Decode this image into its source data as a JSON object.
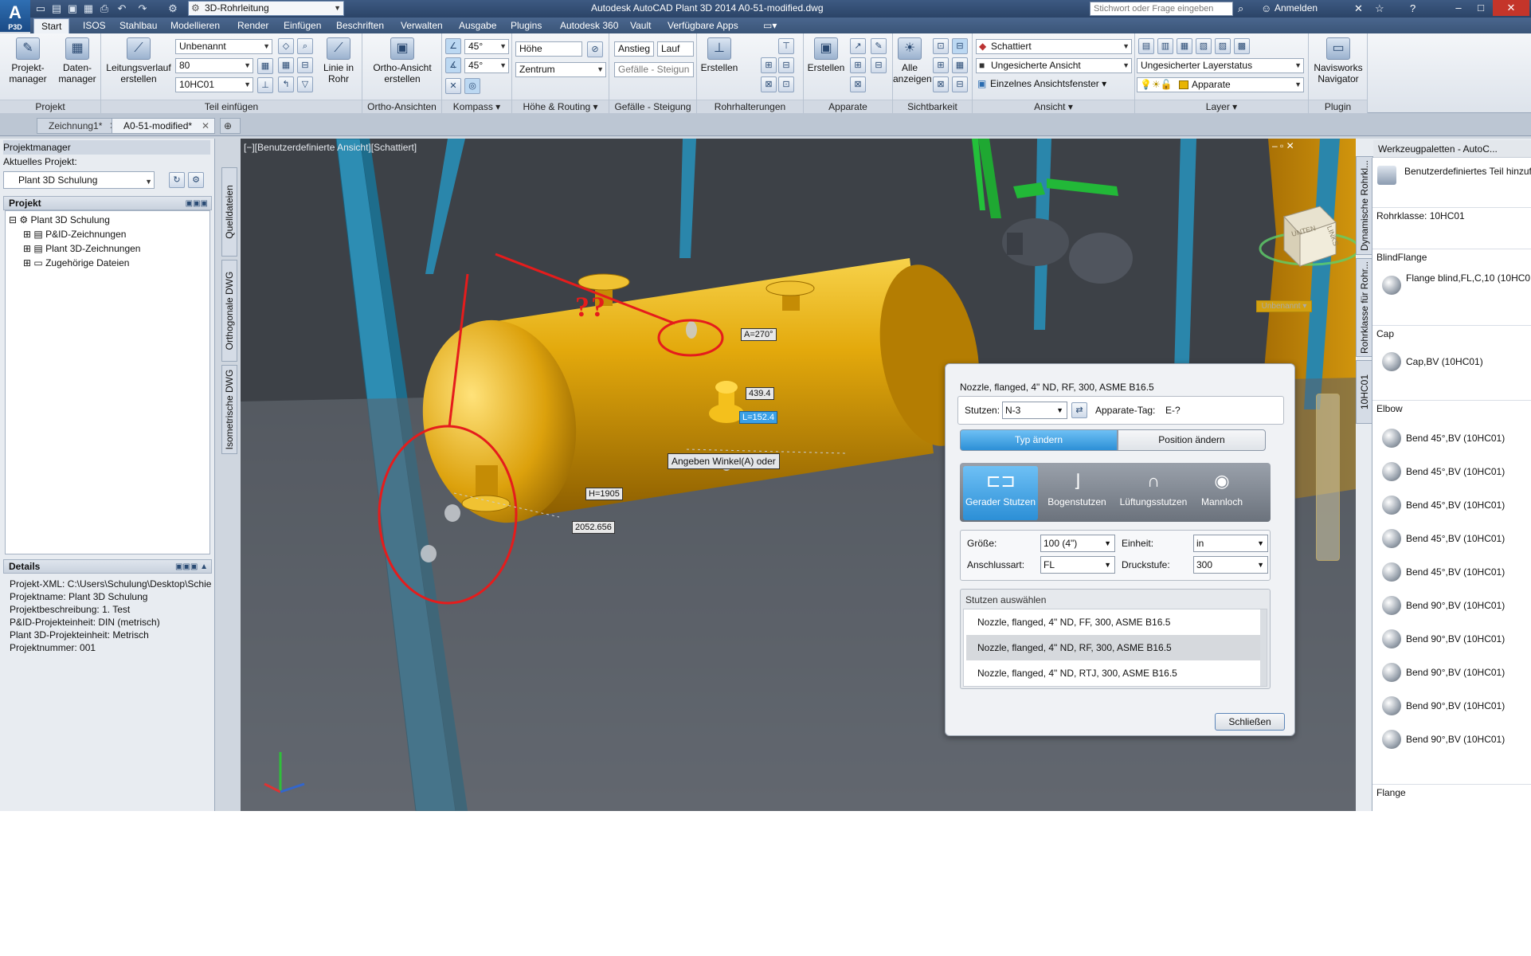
{
  "title_bar": {
    "app_logo": "A",
    "app_logo_sub": "P3D",
    "workspace": "3D-Rohrleitung",
    "app_title": "Autodesk AutoCAD Plant 3D 2014    A0-51-modified.dwg",
    "search_placeholder": "Stichwort oder Frage eingeben",
    "login": "Anmelden"
  },
  "menu_tabs": [
    "Start",
    "ISOS",
    "Stahlbau",
    "Modellieren",
    "Render",
    "Einfügen",
    "Beschriften",
    "Verwalten",
    "Ausgabe",
    "Plugins",
    "Autodesk 360",
    "Vault",
    "Verfügbare Apps"
  ],
  "ribbon": {
    "projekt": {
      "title": "Projekt",
      "btn1": "Projekt-\nmanager",
      "btn2": "Daten-\nmanager"
    },
    "teil": {
      "title": "Teil einfügen",
      "btn_leitung": "Leitungsverlauf\nerstellen",
      "combo1": "Unbenannt",
      "combo2": "80",
      "combo3": "10HC01",
      "btn_linie": "Linie in\nRohr"
    },
    "ortho": {
      "title": "Ortho-Ansichten",
      "btn": "Ortho-Ansicht\nerstellen"
    },
    "kompass": {
      "title": "Kompass",
      "angle1": "45°",
      "angle2": "45°"
    },
    "hoehe": {
      "title": "Höhe & Routing",
      "field1": "Höhe",
      "field2": "Zentrum"
    },
    "gefaelle": {
      "title": "Gefälle - Steigung",
      "field1": "Anstieg",
      "field2": "Lauf",
      "field3": "Gefälle - Steigun"
    },
    "rohrhalter": {
      "title": "Rohrhalterungen",
      "btn": "Erstellen"
    },
    "apparate": {
      "title": "Apparate",
      "btn": "Erstellen"
    },
    "sichtbarkeit": {
      "title": "Sichtbarkeit",
      "btn": "Alle\nanzeigen"
    },
    "ansicht": {
      "title": "Ansicht",
      "combo1": "Schattiert",
      "combo2": "Ungesicherte Ansicht",
      "combo3": "Einzelnes Ansichtsfenster"
    },
    "layer": {
      "title": "Layer",
      "combo1": "Ungesicherter Layerstatus",
      "combo2": "Apparate"
    },
    "plugin": {
      "title": "Plugin",
      "btn": "Navisworks\nNavigator"
    }
  },
  "doc_tabs": [
    "Zeichnung1*",
    "A0-51-modified*"
  ],
  "left_palette": {
    "title": "Projektmanager",
    "current_project_label": "Aktuelles Projekt:",
    "current_project": "Plant 3D Schulung",
    "projekt_section": "Projekt",
    "tree": [
      "Plant 3D Schulung",
      "P&ID-Zeichnungen",
      "Plant 3D-Zeichnungen",
      "Zugehörige Dateien"
    ],
    "details_section": "Details",
    "details": [
      "Projekt-XML:  C:\\Users\\Schulung\\Desktop\\Schie",
      "Projektname:  Plant 3D Schulung",
      "Projektbeschreibung:  1. Test",
      "P&ID-Projekteinheit:  DIN  (metrisch)",
      "Plant 3D-Projekteinheit:  Metrisch",
      "Projektnummer: 001"
    ],
    "side_tabs": [
      "Quelldateien",
      "Orthogonale DWG",
      "Isometrische DWG"
    ]
  },
  "viewport": {
    "label": "[−][Benutzerdefinierte Ansicht][Schattiert]",
    "annotation": "??",
    "viewcube_top": "UNTEN",
    "viewcube_side": "LINKS",
    "viewcube_dropdown": "Unbenannt",
    "dim_angle": "A=270°",
    "dim_1": "439.4",
    "dim_2": "L=152.4",
    "prompt": "Angeben Winkel(A) oder",
    "dim_h": "H=1905",
    "dim_3": "2052.656"
  },
  "dialog": {
    "header": "Nozzle, flanged, 4\" ND, RF, 300, ASME B16.5",
    "stutzen_label": "Stutzen:",
    "stutzen_value": "N-3",
    "tag_label": "Apparate-Tag:",
    "tag_value": "E-?",
    "tab_type": "Typ ändern",
    "tab_position": "Position ändern",
    "types": [
      "Gerader Stutzen",
      "Bogenstutzen",
      "Lüftungsstutzen",
      "Mannloch"
    ],
    "groesse_label": "Größe:",
    "groesse_value": "100 (4\")",
    "einheit_label": "Einheit:",
    "einheit_value": "in",
    "anschluss_label": "Anschlussart:",
    "anschluss_value": "FL",
    "druck_label": "Druckstufe:",
    "druck_value": "300",
    "list_title": "Stutzen auswählen",
    "list": [
      "Nozzle, flanged, 4\" ND, FF, 300, ASME B16.5",
      "Nozzle, flanged, 4\" ND, RF, 300, ASME B16.5",
      "Nozzle, flanged, 4\" ND, RTJ, 300, ASME B16.5"
    ],
    "close": "Schließen"
  },
  "right_palette": {
    "title": "Werkzeugpaletten - AutoC...",
    "side_tabs": [
      "Dynamische Rohrkl...",
      "Rohrklasse für Rohr...",
      "10HC01"
    ],
    "add_custom": "Benutzerdefiniertes Teil\nhinzufügen",
    "rohrklasse": "Rohrklasse: 10HC01",
    "sec_blind": "BlindFlange",
    "item_blind": "Flange blind,FL,C,10\n(10HC01)",
    "sec_cap": "Cap",
    "item_cap": "Cap,BV (10HC01)",
    "sec_elbow": "Elbow",
    "elbows": [
      "Bend 45°,BV (10HC01)",
      "Bend 45°,BV (10HC01)",
      "Bend 45°,BV (10HC01)",
      "Bend 45°,BV (10HC01)",
      "Bend 45°,BV (10HC01)",
      "Bend 90°,BV (10HC01)",
      "Bend 90°,BV (10HC01)",
      "Bend 90°,BV (10HC01)",
      "Bend 90°,BV (10HC01)",
      "Bend 90°,BV (10HC01)"
    ],
    "sec_flange": "Flange"
  },
  "colors": {
    "vessel": "#d9a20a",
    "steel": "#2f8fb3",
    "annotation": "#e51c1c",
    "accent": "#3aa0e6"
  }
}
